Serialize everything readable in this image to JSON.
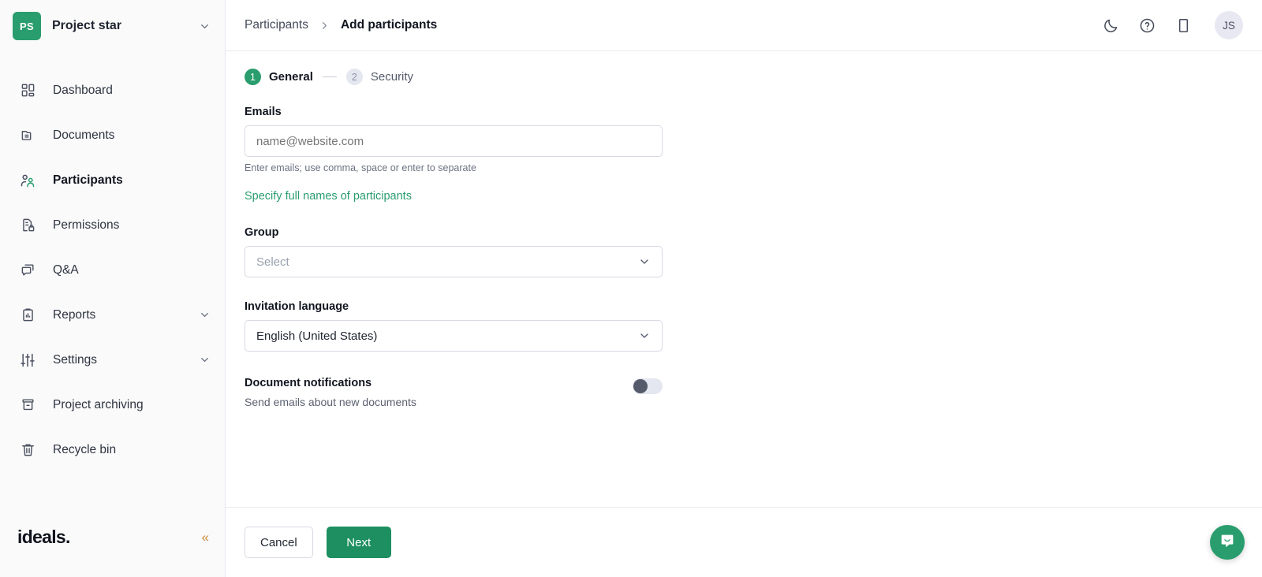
{
  "sidebar": {
    "project": {
      "initials": "PS",
      "name": "Project star",
      "chevron_icon": "chevron-down-icon"
    },
    "items": [
      {
        "label": "Dashboard",
        "icon": "dashboard-grid-icon",
        "active": false,
        "caret": false
      },
      {
        "label": "Documents",
        "icon": "document-folder-icon",
        "active": false,
        "caret": false
      },
      {
        "label": "Participants",
        "icon": "participants-icon",
        "active": true,
        "caret": false
      },
      {
        "label": "Permissions",
        "icon": "document-lock-icon",
        "active": false,
        "caret": false
      },
      {
        "label": "Q&A",
        "icon": "chat-bubbles-icon",
        "active": false,
        "caret": false
      },
      {
        "label": "Reports",
        "icon": "clipboard-chart-icon",
        "active": false,
        "caret": true
      },
      {
        "label": "Settings",
        "icon": "sliders-icon",
        "active": false,
        "caret": true
      },
      {
        "label": "Project archiving",
        "icon": "archive-box-icon",
        "active": false,
        "caret": false
      },
      {
        "label": "Recycle bin",
        "icon": "trash-icon",
        "active": false,
        "caret": false
      }
    ],
    "brand": "ideals.",
    "collapse_label": "«"
  },
  "topbar": {
    "breadcrumb": {
      "parent": "Participants",
      "separator_icon": "chevron-right-icon",
      "current": "Add participants"
    },
    "actions": [
      {
        "name": "dark-mode-icon"
      },
      {
        "name": "help-icon"
      },
      {
        "name": "mobile-app-icon"
      }
    ],
    "avatar_initials": "JS"
  },
  "stepper": {
    "steps": [
      {
        "number": "1",
        "label": "General",
        "state": "active"
      },
      {
        "number": "2",
        "label": "Security",
        "state": "todo"
      }
    ]
  },
  "form": {
    "emails": {
      "label": "Emails",
      "value": "",
      "placeholder": "name@website.com",
      "hint": "Enter emails; use comma, space or enter to separate",
      "link": "Specify full names of participants"
    },
    "group": {
      "label": "Group",
      "value": "",
      "placeholder": "Select",
      "chevron_icon": "chevron-down-icon"
    },
    "invitation_language": {
      "label": "Invitation language",
      "value": "English (United States)",
      "chevron_icon": "chevron-down-icon"
    },
    "document_notifications": {
      "label": "Document notifications",
      "description": "Send emails about new documents",
      "state": "off"
    }
  },
  "footer": {
    "cancel_label": "Cancel",
    "next_label": "Next"
  },
  "chat": {
    "icon": "chat-support-icon"
  },
  "colors": {
    "brand_green": "#2a9d6e",
    "primary_button": "#1d8f60",
    "sidebar_bg": "#fafafb",
    "border": "#e6e8ef",
    "text": "#11151f",
    "muted_text": "#6c7280",
    "collapse_orange": "#c98a3c"
  }
}
